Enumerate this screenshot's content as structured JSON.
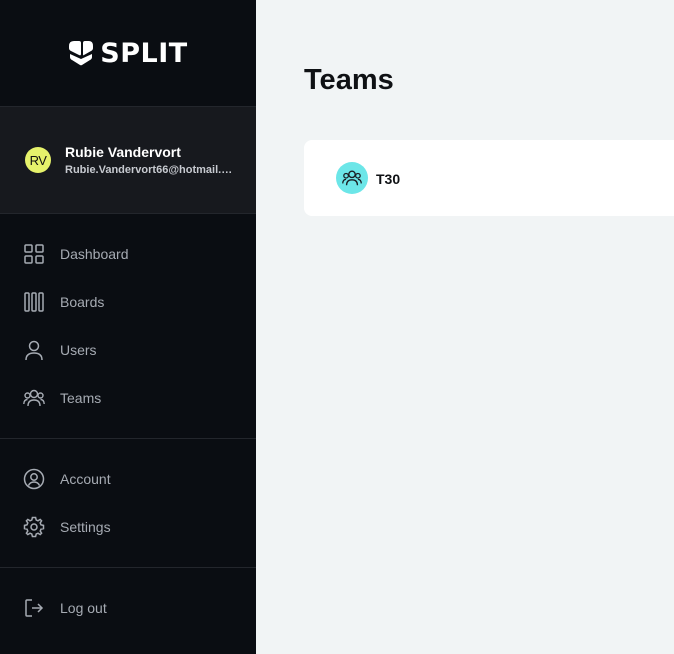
{
  "brand": {
    "name": "SPLIT"
  },
  "user": {
    "initials": "RV",
    "name": "Rubie Vandervort",
    "email": "Rubie.Vandervort66@hotmail.com"
  },
  "nav": {
    "main": [
      {
        "label": "Dashboard",
        "icon": "dashboard-grid-icon"
      },
      {
        "label": "Boards",
        "icon": "boards-columns-icon"
      },
      {
        "label": "Users",
        "icon": "user-icon"
      },
      {
        "label": "Teams",
        "icon": "teams-icon"
      }
    ],
    "secondary": [
      {
        "label": "Account",
        "icon": "account-circle-icon"
      },
      {
        "label": "Settings",
        "icon": "gear-icon"
      }
    ],
    "logout": {
      "label": "Log out",
      "icon": "logout-icon"
    }
  },
  "page": {
    "title": "Teams"
  },
  "teams": [
    {
      "name": "T30",
      "icon": "teams-icon"
    }
  ],
  "colors": {
    "sidebar_bg": "#0a0d12",
    "user_block_bg": "#17191e",
    "avatar_bg": "#e6f26b",
    "team_avatar_bg": "#6ce6e8",
    "content_bg": "#f1f4f5",
    "nav_text": "#a6abb3"
  }
}
